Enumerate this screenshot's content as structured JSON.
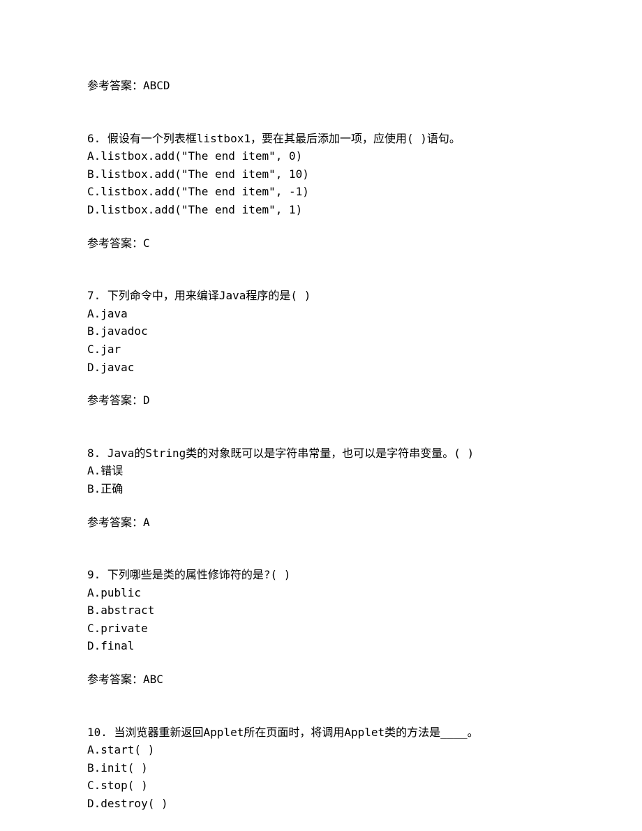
{
  "answer_prev": "参考答案：ABCD",
  "q6": {
    "stem": "6. 假设有一个列表框listbox1，要在其最后添加一项，应使用(  )语句。",
    "options": [
      "A.listbox.add(\"The end item\", 0)",
      "B.listbox.add(\"The end item\", 10)",
      "C.listbox.add(\"The end item\", -1)",
      "D.listbox.add(\"The end item\", 1)"
    ],
    "answer": "参考答案：C"
  },
  "q7": {
    "stem": "7. 下列命令中，用来编译Java程序的是(  )",
    "options": [
      "A.java",
      "B.javadoc",
      "C.jar",
      "D.javac"
    ],
    "answer": "参考答案：D"
  },
  "q8": {
    "stem": "8. Java的String类的对象既可以是字符串常量，也可以是字符串变量。(  )",
    "options": [
      "A.错误",
      "B.正确"
    ],
    "answer": "参考答案：A"
  },
  "q9": {
    "stem": "9. 下列哪些是类的属性修饰符的是?(  )",
    "options": [
      "A.public",
      "B.abstract",
      "C.private",
      "D.final"
    ],
    "answer": "参考答案：ABC"
  },
  "q10": {
    "stem": "10. 当浏览器重新返回Applet所在页面时，将调用Applet类的方法是____。",
    "options": [
      "A.start(  )",
      "B.init(  )",
      "C.stop(  )",
      "D.destroy(  )"
    ]
  }
}
